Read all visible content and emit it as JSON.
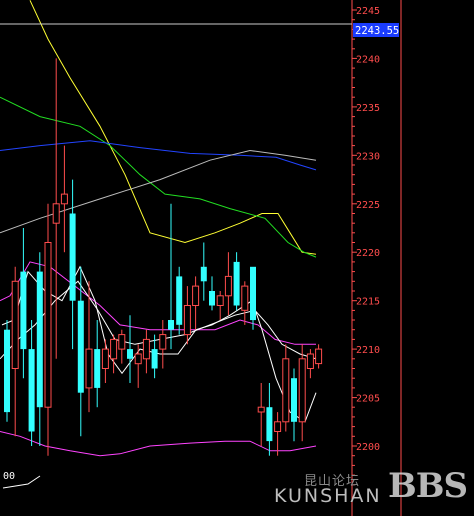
{
  "colors": {
    "background": "#000000",
    "axis": "#ff4d4d",
    "bull": "#ff4d4d",
    "bear": "#33ffff",
    "ma5": "#ffffff",
    "ma10": "#ffff33",
    "ma20": "#ff44ff",
    "ma30": "#22dd22",
    "ma60": "#2244ff",
    "ma120": "#bbbbbb",
    "current_label_bg": "#1a3cff"
  },
  "chart_data": {
    "type": "candlestick",
    "ylim": [
      2198,
      2246
    ],
    "y_ticks": [
      "2245",
      "2240",
      "2235",
      "2230",
      "2225",
      "2220",
      "2215",
      "2210",
      "2205",
      "2200"
    ],
    "current_price_label": "2243.55",
    "current_price": 2243.55,
    "bottom_left_label": "00",
    "candles": [
      {
        "o": 2212.0,
        "h": 2213.0,
        "l": 2202.5,
        "c": 2203.5
      },
      {
        "o": 2208.0,
        "h": 2218.5,
        "l": 2201.0,
        "c": 2217.0
      },
      {
        "o": 2218.0,
        "h": 2222.5,
        "l": 2207.0,
        "c": 2210.0
      },
      {
        "o": 2210.0,
        "h": 2213.0,
        "l": 2200.0,
        "c": 2201.5
      },
      {
        "o": 2218.0,
        "h": 2220.0,
        "l": 2200.0,
        "c": 2204.0
      },
      {
        "o": 2204.0,
        "h": 2225.0,
        "l": 2199.0,
        "c": 2221.0
      },
      {
        "o": 2223.0,
        "h": 2240.0,
        "l": 2209.0,
        "c": 2225.0
      },
      {
        "o": 2225.0,
        "h": 2231.0,
        "l": 2220.0,
        "c": 2226.0
      },
      {
        "o": 2224.0,
        "h": 2227.5,
        "l": 2210.0,
        "c": 2215.0
      },
      {
        "o": 2215.0,
        "h": 2218.5,
        "l": 2201.0,
        "c": 2205.5
      },
      {
        "o": 2206.0,
        "h": 2217.0,
        "l": 2203.5,
        "c": 2210.0
      },
      {
        "o": 2210.0,
        "h": 2213.0,
        "l": 2204.0,
        "c": 2206.0
      },
      {
        "o": 2208.0,
        "h": 2211.0,
        "l": 2206.5,
        "c": 2210.0
      },
      {
        "o": 2209.0,
        "h": 2211.5,
        "l": 2207.5,
        "c": 2211.0
      },
      {
        "o": 2210.0,
        "h": 2212.0,
        "l": 2208.5,
        "c": 2211.5
      },
      {
        "o": 2210.0,
        "h": 2213.5,
        "l": 2206.5,
        "c": 2209.0
      },
      {
        "o": 2208.5,
        "h": 2210.5,
        "l": 2206.0,
        "c": 2209.5
      },
      {
        "o": 2209.0,
        "h": 2212.0,
        "l": 2207.5,
        "c": 2211.0
      },
      {
        "o": 2210.0,
        "h": 2211.5,
        "l": 2207.0,
        "c": 2208.0
      },
      {
        "o": 2210.0,
        "h": 2213.0,
        "l": 2208.0,
        "c": 2211.5
      },
      {
        "o": 2213.0,
        "h": 2225.0,
        "l": 2210.0,
        "c": 2212.0
      },
      {
        "o": 2217.5,
        "h": 2218.5,
        "l": 2211.5,
        "c": 2212.5
      },
      {
        "o": 2211.5,
        "h": 2216.5,
        "l": 2210.5,
        "c": 2214.5
      },
      {
        "o": 2214.5,
        "h": 2217.5,
        "l": 2212.0,
        "c": 2216.5
      },
      {
        "o": 2218.5,
        "h": 2221.0,
        "l": 2215.0,
        "c": 2217.0
      },
      {
        "o": 2216.0,
        "h": 2217.5,
        "l": 2214.0,
        "c": 2214.5
      },
      {
        "o": 2214.5,
        "h": 2216.0,
        "l": 2213.0,
        "c": 2215.5
      },
      {
        "o": 2215.5,
        "h": 2220.0,
        "l": 2213.5,
        "c": 2217.5
      },
      {
        "o": 2219.0,
        "h": 2220.0,
        "l": 2214.0,
        "c": 2214.5
      },
      {
        "o": 2214.0,
        "h": 2217.0,
        "l": 2212.5,
        "c": 2216.5
      },
      {
        "o": 2218.5,
        "h": 2218.0,
        "l": 2212.0,
        "c": 2213.0
      },
      {
        "o": 2203.5,
        "h": 2206.5,
        "l": 2200.0,
        "c": 2204.0
      },
      {
        "o": 2204.0,
        "h": 2206.5,
        "l": 2199.0,
        "c": 2200.5
      },
      {
        "o": 2201.5,
        "h": 2203.5,
        "l": 2199.0,
        "c": 2202.5
      },
      {
        "o": 2202.5,
        "h": 2210.5,
        "l": 2201.5,
        "c": 2209.0
      },
      {
        "o": 2207.0,
        "h": 2208.0,
        "l": 2200.5,
        "c": 2202.5
      },
      {
        "o": 2202.5,
        "h": 2210.5,
        "l": 2200.5,
        "c": 2209.0
      },
      {
        "o": 2208.0,
        "h": 2210.0,
        "l": 2207.0,
        "c": 2209.5
      },
      {
        "o": 2208.5,
        "h": 2210.5,
        "l": 2208.0,
        "c": 2210.0
      }
    ],
    "moving_averages": [
      {
        "key": "ma10",
        "points": [
          [
            30,
            2246
          ],
          [
            48,
            2242
          ],
          [
            70,
            2238
          ],
          [
            100,
            2233
          ],
          [
            125,
            2228
          ],
          [
            150,
            2222
          ],
          [
            185,
            2221
          ],
          [
            215,
            2222
          ],
          [
            240,
            2223
          ],
          [
            262,
            2224
          ],
          [
            278,
            2224
          ],
          [
            290,
            2222
          ],
          [
            302,
            2220
          ],
          [
            316,
            2219.8
          ]
        ]
      },
      {
        "key": "ma30",
        "points": [
          [
            0,
            2236
          ],
          [
            40,
            2234
          ],
          [
            80,
            2233
          ],
          [
            110,
            2231
          ],
          [
            140,
            2228
          ],
          [
            165,
            2226
          ],
          [
            200,
            2225.5
          ],
          [
            230,
            2224.5
          ],
          [
            265,
            2223.5
          ],
          [
            288,
            2221
          ],
          [
            304,
            2220
          ],
          [
            316,
            2219.5
          ]
        ]
      },
      {
        "key": "ma60",
        "points": [
          [
            0,
            2230.5
          ],
          [
            40,
            2231
          ],
          [
            90,
            2231.5
          ],
          [
            140,
            2230.8
          ],
          [
            190,
            2230.2
          ],
          [
            240,
            2230
          ],
          [
            276,
            2229.8
          ],
          [
            300,
            2229
          ],
          [
            316,
            2228.5
          ]
        ]
      },
      {
        "key": "ma120",
        "points": [
          [
            0,
            2222
          ],
          [
            40,
            2223.5
          ],
          [
            100,
            2225.5
          ],
          [
            160,
            2227.5
          ],
          [
            210,
            2229.5
          ],
          [
            250,
            2230.5
          ],
          [
            285,
            2230
          ],
          [
            316,
            2229.5
          ]
        ]
      },
      {
        "key": "ma20",
        "points": [
          [
            0,
            2215
          ],
          [
            10,
            2215.5
          ],
          [
            30,
            2219
          ],
          [
            50,
            2218.5
          ],
          [
            75,
            2216.5
          ],
          [
            100,
            2214.5
          ],
          [
            120,
            2212.5
          ],
          [
            150,
            2212
          ],
          [
            185,
            2212
          ],
          [
            215,
            2212
          ],
          [
            240,
            2213
          ],
          [
            258,
            2212.5
          ],
          [
            275,
            2211
          ],
          [
            295,
            2210.5
          ],
          [
            316,
            2210.5
          ]
        ]
      },
      {
        "key": "ma20",
        "points": [
          [
            0,
            2201.5
          ],
          [
            20,
            2201
          ],
          [
            45,
            2200
          ],
          [
            70,
            2199.5
          ],
          [
            100,
            2199
          ],
          [
            120,
            2199.2
          ],
          [
            150,
            2200
          ],
          [
            190,
            2200.3
          ],
          [
            225,
            2200.5
          ],
          [
            250,
            2200.5
          ],
          [
            270,
            2199.5
          ],
          [
            290,
            2199.5
          ],
          [
            316,
            2200
          ]
        ]
      },
      {
        "key": "ma5",
        "points": [
          [
            2,
            2212.5
          ],
          [
            14,
            2213
          ],
          [
            28,
            2218
          ],
          [
            45,
            2216
          ],
          [
            62,
            2215
          ],
          [
            80,
            2218.5
          ],
          [
            95,
            2215
          ],
          [
            108,
            2209.5
          ],
          [
            122,
            2207.5
          ],
          [
            140,
            2210
          ],
          [
            160,
            2209.5
          ],
          [
            178,
            2209.5
          ],
          [
            196,
            2212
          ],
          [
            212,
            2212.5
          ],
          [
            230,
            2213.5
          ],
          [
            252,
            2215
          ],
          [
            262,
            2212
          ],
          [
            276,
            2207
          ],
          [
            290,
            2203.5
          ],
          [
            305,
            2202.5
          ],
          [
            316,
            2205.5
          ]
        ]
      },
      {
        "key": "ma5",
        "points": [
          [
            0,
            2209
          ],
          [
            18,
            2211
          ],
          [
            35,
            2212.5
          ],
          [
            55,
            2215
          ],
          [
            78,
            2217
          ],
          [
            98,
            2214
          ],
          [
            115,
            2211
          ],
          [
            135,
            2210.5
          ],
          [
            160,
            2211
          ],
          [
            185,
            2211.5
          ],
          [
            210,
            2212.5
          ],
          [
            235,
            2213.5
          ],
          [
            255,
            2214
          ],
          [
            268,
            2212.5
          ],
          [
            282,
            2210.5
          ],
          [
            300,
            2209.5
          ],
          [
            316,
            2209
          ]
        ]
      }
    ]
  }
}
